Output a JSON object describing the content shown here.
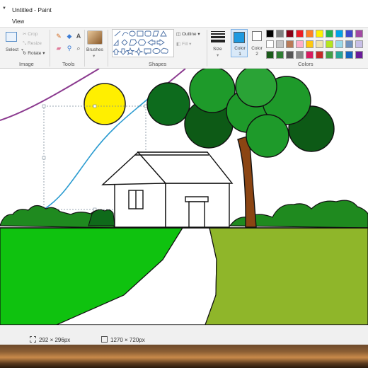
{
  "window": {
    "title": "Untitled - Paint"
  },
  "menu": {
    "view_tab": "View"
  },
  "ribbon": {
    "groups": {
      "image": "Image",
      "tools": "Tools",
      "shapes": "Shapes",
      "colors": "Colors"
    },
    "image": {
      "select": "Select",
      "crop": "Crop",
      "resize": "Resize",
      "rotate": "Rotate"
    },
    "brushes": "Brushes",
    "shapes": {
      "outline": "Outline",
      "fill": "Fill"
    },
    "size": "Size",
    "color1": "Color 1",
    "color2": "Color 2",
    "color1_value": "#1f9ae0",
    "color2_value": "#ffffff",
    "palette": [
      "#000000",
      "#7f7f7f",
      "#880015",
      "#ed1c24",
      "#ff7f27",
      "#fff200",
      "#22b14c",
      "#00a2e8",
      "#3f48cc",
      "#a349a4",
      "#ffffff",
      "#c3c3c3",
      "#b97a57",
      "#ffaec9",
      "#ffc90e",
      "#efe4b0",
      "#b5e61d",
      "#99d9ea",
      "#7092be",
      "#c8bfe7",
      "#1a5a1a",
      "#2e7d32",
      "#555555",
      "#888888",
      "#d81b60",
      "#c62828",
      "#43a047",
      "#26a69a",
      "#1565c0",
      "#6a1b9a"
    ]
  },
  "status": {
    "selection_size": "292 × 296px",
    "canvas_size": "1270 × 720px"
  }
}
